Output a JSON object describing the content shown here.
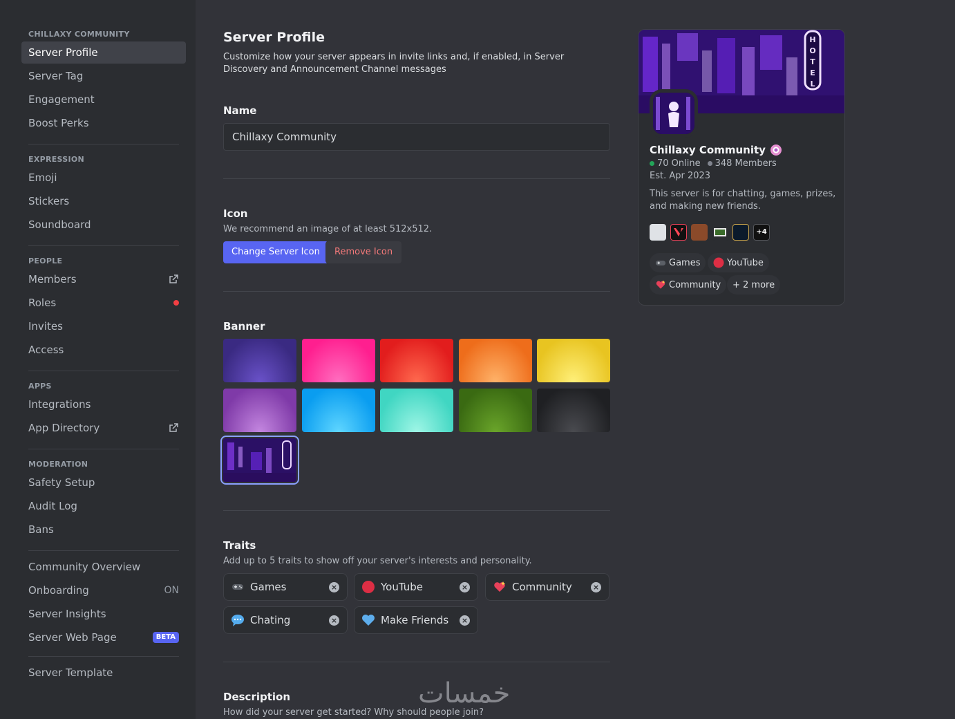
{
  "sidebar": {
    "server_header": "CHILLAXY COMMUNITY",
    "main_items": [
      "Server Profile",
      "Server Tag",
      "Engagement",
      "Boost Perks"
    ],
    "expression": {
      "header": "EXPRESSION",
      "items": [
        "Emoji",
        "Stickers",
        "Soundboard"
      ]
    },
    "people": {
      "header": "PEOPLE",
      "items": [
        "Members",
        "Roles",
        "Invites",
        "Access"
      ]
    },
    "apps": {
      "header": "APPS",
      "items": [
        "Integrations",
        "App Directory"
      ]
    },
    "moderation": {
      "header": "MODERATION",
      "items": [
        "Safety Setup",
        "Audit Log",
        "Bans"
      ]
    },
    "community": {
      "items": [
        "Community Overview",
        "Onboarding",
        "Server Insights",
        "Server Web Page"
      ],
      "onboarding_status": "ON",
      "beta_label": "BETA"
    },
    "template_item": "Server Template"
  },
  "main": {
    "title": "Server Profile",
    "description": "Customize how your server appears in invite links and, if enabled, in Server Discovery and Announcement Channel messages",
    "name_label": "Name",
    "name_value": "Chillaxy Community",
    "icon_label": "Icon",
    "icon_hint": "We recommend an image of at least 512x512.",
    "change_icon_button": "Change Server Icon",
    "remove_icon_button": "Remove Icon",
    "banner_label": "Banner",
    "banner_colors": [
      [
        "#3a2a82",
        "#6a52c9"
      ],
      [
        "#ff1f8f",
        "#ff6fc0"
      ],
      [
        "#e21d1d",
        "#ff6a4f"
      ],
      [
        "#ee6d1b",
        "#ffb36a"
      ],
      [
        "#e8c421",
        "#fff07a"
      ],
      [
        "#7f3aa8",
        "#c487e0"
      ],
      [
        "#0a9df0",
        "#5fd6ff"
      ],
      [
        "#40d6c2",
        "#9ff6e6"
      ],
      [
        "#3a6a12",
        "#6aa52a"
      ],
      [
        "#1f2023",
        "#4a4b50"
      ]
    ],
    "traits_label": "Traits",
    "traits_hint": "Add up to 5 traits to show off your server's interests and personality.",
    "traits": [
      {
        "label": "Games",
        "icon": "gamepad-icon"
      },
      {
        "label": "YouTube",
        "icon": "red-circle-icon"
      },
      {
        "label": "Community",
        "icon": "sparkling-heart-icon"
      },
      {
        "label": "Chating",
        "icon": "speech-bubble-icon"
      },
      {
        "label": "Make Friends",
        "icon": "blue-heart-icon"
      }
    ],
    "description_label": "Description",
    "description_hint": "How did your server get started? Why should people join?"
  },
  "preview": {
    "name": "Chillaxy Community",
    "online": "70 Online",
    "members": "348 Members",
    "established": "Est. Apr 2023",
    "about": "This server is for chatting, games, prizes, and making new friends.",
    "more_games": "+4",
    "chips": [
      "Games",
      "YouTube",
      "Community",
      "+ 2 more"
    ],
    "banner_sign_text": "HOTEL"
  },
  "watermark": "خمسات",
  "colors": {
    "accent": "#5865f2",
    "online": "#23a559",
    "danger": "#f57a7a"
  }
}
